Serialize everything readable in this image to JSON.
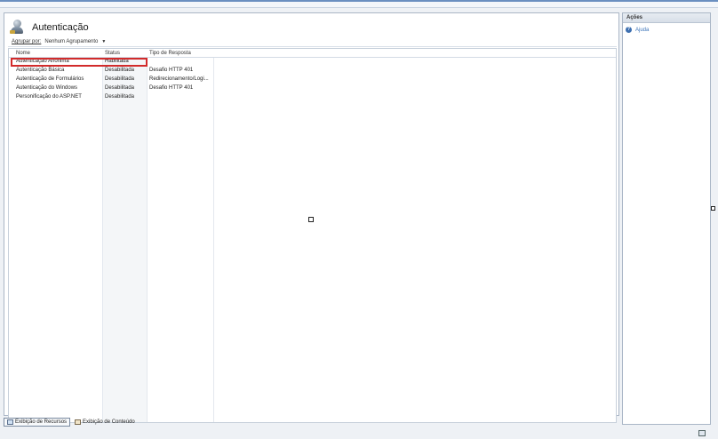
{
  "window": {
    "title": "Autenticação"
  },
  "toolbar": {
    "group_label": "Agrupar por:",
    "group_value": "Nenhum Agrupamento"
  },
  "table": {
    "headers": [
      "Nome",
      "Status",
      "Tipo de Resposta"
    ],
    "rows": [
      {
        "name": "Autenticação Anônima",
        "status": "Habilitada",
        "response": ""
      },
      {
        "name": "Autenticação Básica",
        "status": "Desabilitada",
        "response": "Desafio HTTP 401"
      },
      {
        "name": "Autenticação de Formulários",
        "status": "Desabilitada",
        "response": "Redirecionamento/Logi..."
      },
      {
        "name": "Autenticação do Windows",
        "status": "Desabilitada",
        "response": "Desafio HTTP 401"
      },
      {
        "name": "Personificação do ASP.NET",
        "status": "Desabilitada",
        "response": ""
      }
    ],
    "selected_row": 0
  },
  "tabs": [
    {
      "label": "Exibição de Recursos",
      "active": true
    },
    {
      "label": "Exibição de Conteúdo",
      "active": false
    }
  ],
  "actions": {
    "title": "Ações",
    "items": [
      {
        "label": "Ajuda",
        "icon": "help-icon"
      }
    ]
  },
  "colors": {
    "highlight": "#d22b2b",
    "link": "#3a73b8",
    "accent": "#6a8fc0"
  }
}
